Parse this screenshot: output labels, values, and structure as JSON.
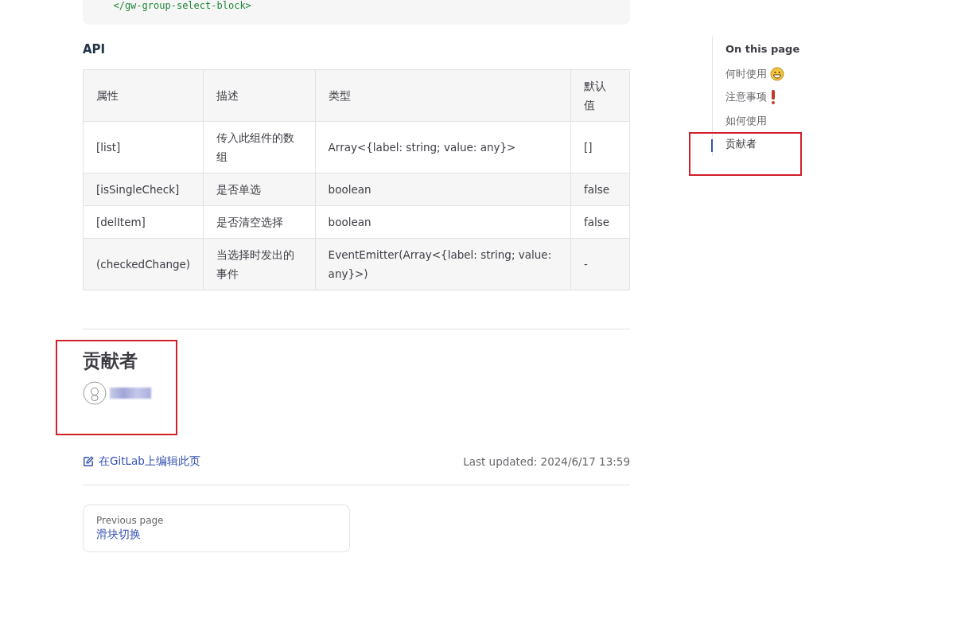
{
  "code_block": {
    "lines": [
      "  </gw-group-select-block>"
    ]
  },
  "api": {
    "title": "API",
    "columns": [
      "属性",
      "描述",
      "类型",
      "默认值"
    ],
    "rows": [
      [
        "[list]",
        "传入此组件的数组",
        "Array<{label: string; value: any}>",
        "[]"
      ],
      [
        "[isSingleCheck]",
        "是否单选",
        "boolean",
        "false"
      ],
      [
        "[delItem]",
        "是否清空选择",
        "boolean",
        "false"
      ],
      [
        "(checkedChange)",
        "当选择时发出的事件",
        "EventEmitter(Array<{label: string; value: any}>)",
        "-"
      ]
    ]
  },
  "contributors": {
    "title": "贡献者"
  },
  "footer": {
    "edit_link": "在GitLab上编辑此页",
    "last_updated": "Last updated: 2024/6/17 13:59"
  },
  "pager": {
    "label": "Previous page",
    "title": "滑块切换"
  },
  "toc": {
    "title": "On this page",
    "items": [
      {
        "label": "何时使用",
        "kind": "smile",
        "selected": false
      },
      {
        "label": "注意事项",
        "kind": "exclamation",
        "selected": false
      },
      {
        "label": "如何使用",
        "selected": false
      },
      {
        "label": "贡献者",
        "selected": true
      }
    ]
  }
}
